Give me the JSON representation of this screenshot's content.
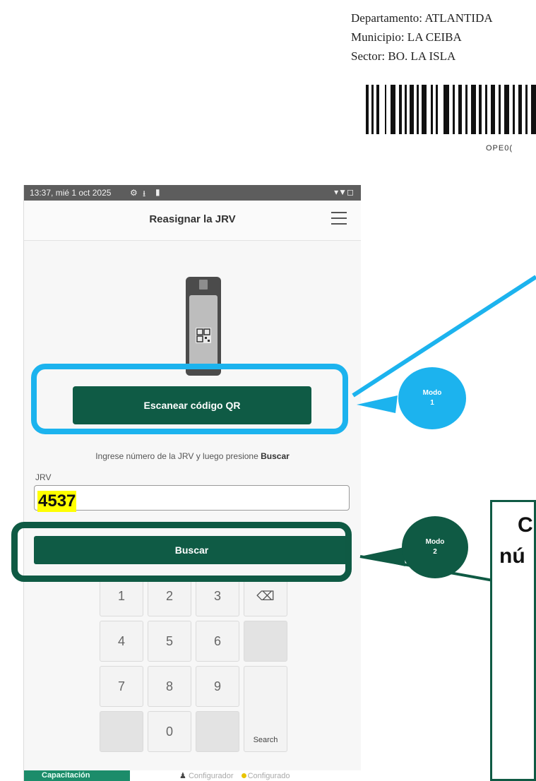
{
  "document": {
    "departamento": "Departamento: ATLANTIDA",
    "municipio": "Municipio: LA CEIBA",
    "sector": "Sector: BO. LA ISLA",
    "barcode_text": "OPE0("
  },
  "status_bar": {
    "time": "13:37, mié 1 oct 2025",
    "icons": [
      "settings-icon",
      "download-icon",
      "battery-icon"
    ],
    "right_icons": "▾▼◻"
  },
  "app_bar": {
    "title": "Reasignar la JRV",
    "menu_icon": "hamburger-menu-icon"
  },
  "scanner": {
    "icon": "qr-scanner-device-icon",
    "button_label": "Escanear código QR"
  },
  "manual_entry": {
    "hint_prefix": "Ingrese número de la JRV y luego presione",
    "hint_action": "Buscar",
    "field_label": "JRV",
    "field_value": "4537",
    "search_button_label": "Buscar"
  },
  "keypad": {
    "keys": [
      "1",
      "2",
      "3",
      "4",
      "5",
      "6",
      "7",
      "8",
      "9",
      "0"
    ],
    "search_key": "Search",
    "backspace_icon": "backspace-icon"
  },
  "bottom_bar": {
    "mode_badge": "Capacitación",
    "user_label": "Configurador",
    "status_label": "Configurado"
  },
  "annotations": {
    "bubble1_line1": "Modo",
    "bubble1_line2": "1",
    "bubble2_line1": "Modo",
    "bubble2_line2": "2",
    "note_line1": "C",
    "note_line2": "nú",
    "colors": {
      "mode1": "#1cb3ee",
      "mode2": "#0f5a44",
      "primary": "#0f5b45",
      "highlight": "#ffff00"
    }
  }
}
